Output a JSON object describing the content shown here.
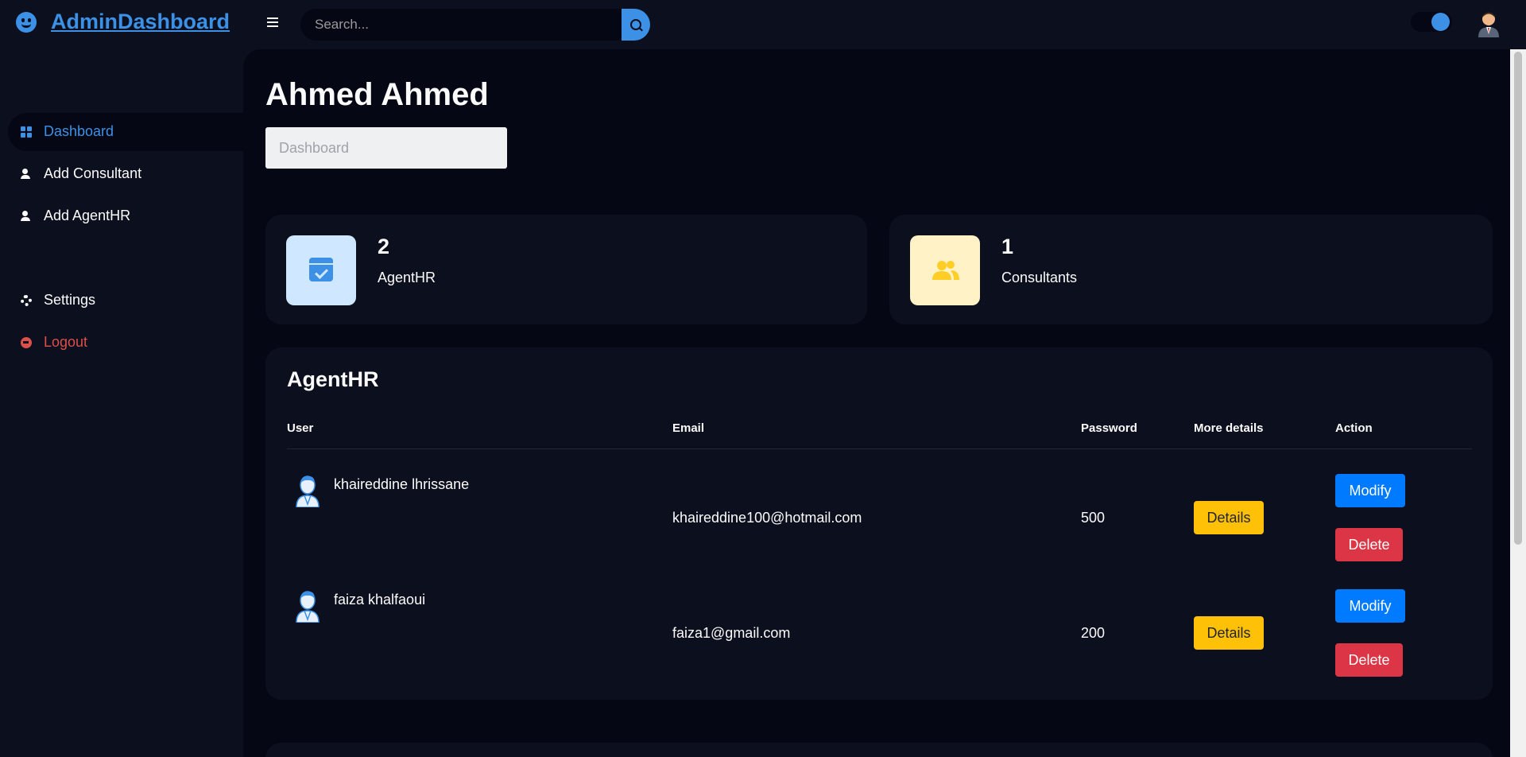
{
  "navbar": {
    "brand": "AdminDashboard",
    "search": {
      "placeholder": "Search..."
    }
  },
  "sidebar": {
    "items": [
      {
        "label": "Dashboard",
        "icon": "dashboard-icon",
        "active": true
      },
      {
        "label": "Add Consultant",
        "icon": "user-add-icon"
      },
      {
        "label": "Add AgentHR",
        "icon": "user-add-icon"
      },
      {
        "label": "Settings",
        "icon": "gear-icon"
      },
      {
        "label": "Logout",
        "icon": "logout-icon"
      }
    ]
  },
  "main": {
    "title": "Ahmed Ahmed",
    "breadcrumb": "Dashboard",
    "stats": [
      {
        "value": "2",
        "label": "AgentHR",
        "icon": "calendar-check-icon"
      },
      {
        "value": "1",
        "label": "Consultants",
        "icon": "group-icon"
      }
    ],
    "table": {
      "title": "AgentHR",
      "columns": [
        "User",
        "Email",
        "Password",
        "More details",
        "Action"
      ],
      "rows": [
        {
          "user": "khaireddine lhrissane",
          "email": "khaireddine100@hotmail.com",
          "password": "500",
          "details": "Details",
          "modify": "Modify",
          "delete": "Delete"
        },
        {
          "user": "faiza khalfaoui",
          "email": "faiza1@gmail.com",
          "password": "200",
          "details": "Details",
          "modify": "Modify",
          "delete": "Delete"
        }
      ]
    }
  },
  "colors": {
    "accent": "#3c91e6",
    "background": "#060714",
    "panel": "#0c0f1d",
    "warning": "#ffc107",
    "primary": "#007bff",
    "danger": "#dc3545"
  }
}
